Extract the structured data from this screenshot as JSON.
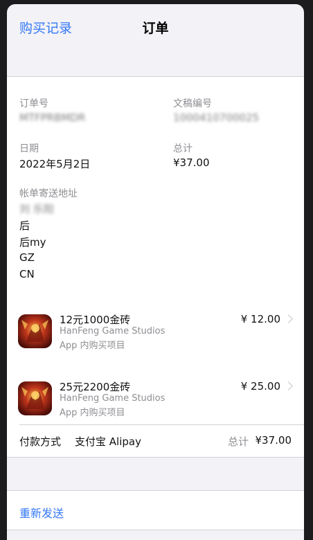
{
  "nav": {
    "back": "购买记录",
    "title": "订单"
  },
  "info": {
    "order_label": "订单号",
    "order_value": "MTFPRBMDR",
    "doc_label": "文稿编号",
    "doc_value": "1000410700025",
    "date_label": "日期",
    "date_value": "2022年5月2日",
    "total_label": "总计",
    "total_value": "¥37.00",
    "address_label": "帐单寄送地址",
    "address_lines": [
      "刘 乐阳",
      "后",
      "后my",
      "GZ",
      "CN"
    ]
  },
  "items": [
    {
      "name": "12元1000金砖",
      "developer": "HanFeng Game Studios",
      "type": "App 内购买项目",
      "price": "¥ 12.00",
      "icon": "game-app-icon"
    },
    {
      "name": "25元2200金砖",
      "developer": "HanFeng Game Studios",
      "type": "App 内购买项目",
      "price": "¥ 25.00",
      "icon": "game-app-icon"
    }
  ],
  "payment": {
    "label": "付款方式",
    "method": "支付宝 Alipay",
    "total_label": "总计",
    "total_value": "¥37.00"
  },
  "resend": {
    "label": "重新发送"
  },
  "colors": {
    "link": "#3478f6",
    "secondary": "#8e8e93",
    "background": "#f2f2f7"
  }
}
